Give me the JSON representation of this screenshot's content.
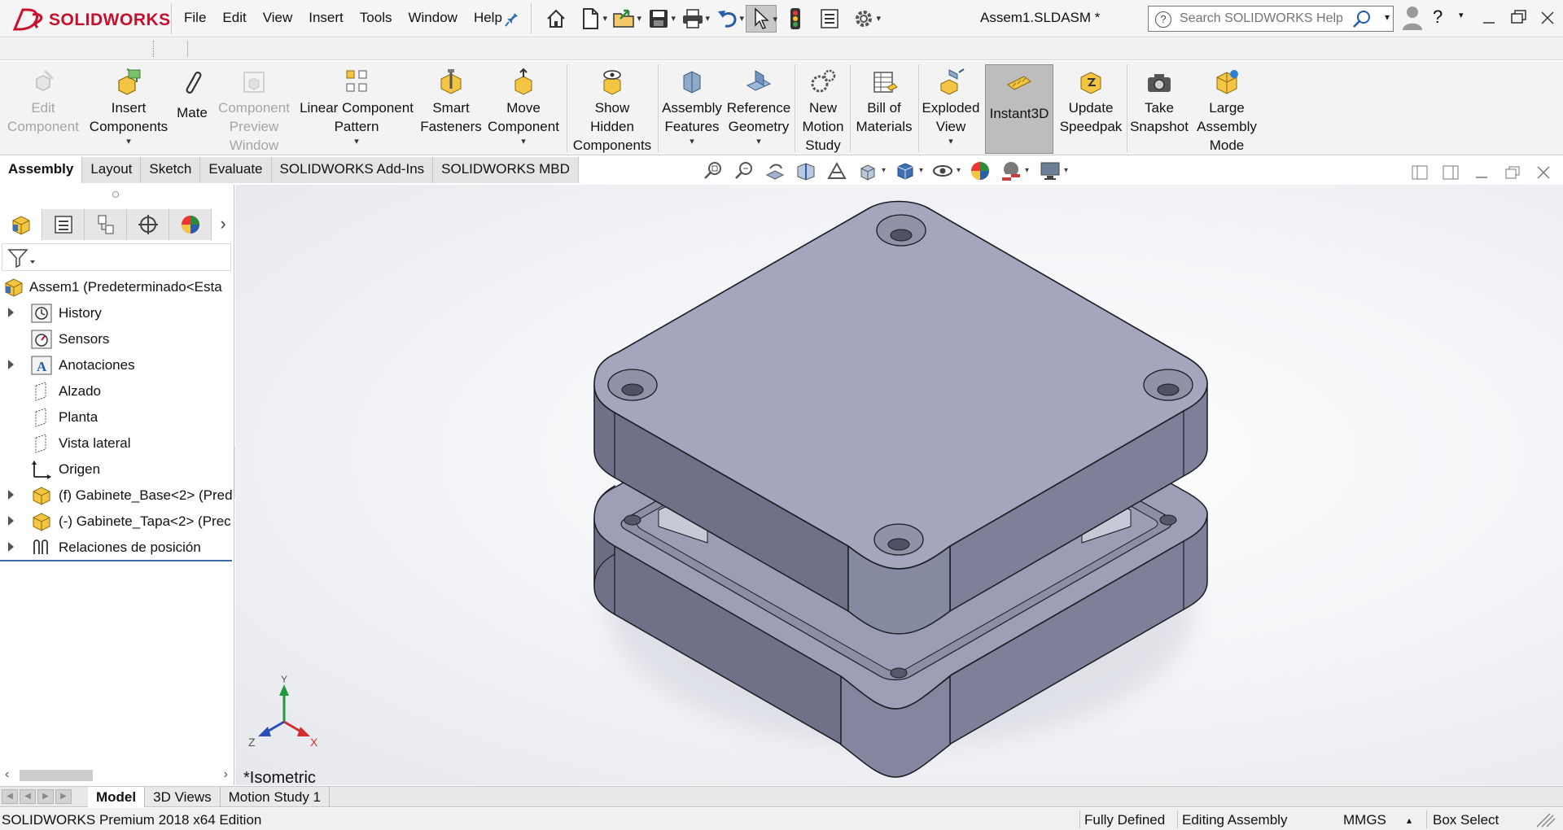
{
  "app": {
    "brand": "SOLIDWORKS",
    "document_title": "Assem1.SLDASM *"
  },
  "menu": [
    "File",
    "Edit",
    "View",
    "Insert",
    "Tools",
    "Window",
    "Help"
  ],
  "search": {
    "placeholder": "Search SOLIDWORKS Help"
  },
  "commands": {
    "edit_component": [
      "Edit",
      "Component"
    ],
    "insert_components": [
      "Insert",
      "Components"
    ],
    "mate": [
      "Mate"
    ],
    "component_preview": [
      "Component",
      "Preview",
      "Window"
    ],
    "linear_pattern": [
      "Linear Component",
      "Pattern"
    ],
    "smart_fasteners": [
      "Smart",
      "Fasteners"
    ],
    "move_component": [
      "Move",
      "Component"
    ],
    "show_hidden": [
      "Show",
      "Hidden",
      "Components"
    ],
    "assembly_features": [
      "Assembly",
      "Features"
    ],
    "reference_geometry": [
      "Reference",
      "Geometry"
    ],
    "new_motion_study": [
      "New",
      "Motion",
      "Study"
    ],
    "bill_of_materials": [
      "Bill of",
      "Materials"
    ],
    "exploded_view": [
      "Exploded",
      "View"
    ],
    "instant3d": [
      "Instant3D"
    ],
    "update_speedpak": [
      "Update",
      "Speedpak"
    ],
    "take_snapshot": [
      "Take",
      "Snapshot"
    ],
    "large_assembly": [
      "Large",
      "Assembly",
      "Mode"
    ]
  },
  "command_tabs": [
    "Assembly",
    "Layout",
    "Sketch",
    "Evaluate",
    "SOLIDWORKS Add-Ins",
    "SOLIDWORKS MBD"
  ],
  "tree": {
    "root": "Assem1  (Predeterminado<Esta",
    "items": [
      {
        "label": "History",
        "expandable": true,
        "icon": "history-icon"
      },
      {
        "label": "Sensors",
        "expandable": false,
        "icon": "sensors-icon"
      },
      {
        "label": "Anotaciones",
        "expandable": true,
        "icon": "annotations-icon"
      },
      {
        "label": "Alzado",
        "expandable": false,
        "icon": "plane-icon"
      },
      {
        "label": "Planta",
        "expandable": false,
        "icon": "plane-icon"
      },
      {
        "label": "Vista lateral",
        "expandable": false,
        "icon": "plane-icon"
      },
      {
        "label": "Origen",
        "expandable": false,
        "icon": "origin-icon"
      },
      {
        "label": "(f) Gabinete_Base<2> (Pred",
        "expandable": true,
        "icon": "part-icon"
      },
      {
        "label": "(-) Gabinete_Tapa<2> (Prec",
        "expandable": true,
        "icon": "part-icon"
      },
      {
        "label": "Relaciones de posición",
        "expandable": true,
        "icon": "mates-icon"
      }
    ]
  },
  "viewport": {
    "view_name": "*Isometric",
    "triad": {
      "x": "X",
      "y": "Y",
      "z": "Z"
    }
  },
  "bottom_tabs": [
    "Model",
    "3D Views",
    "Motion Study 1"
  ],
  "status": {
    "edition": "SOLIDWORKS Premium 2018 x64 Edition",
    "definition": "Fully Defined",
    "mode": "Editing Assembly",
    "units": "MMGS",
    "selection": "Box Select"
  },
  "colors": {
    "brand_red": "#c8102e",
    "model_top": "#a3a6bd",
    "model_side": "#7c7f96",
    "model_dark": "#6a6d83"
  }
}
